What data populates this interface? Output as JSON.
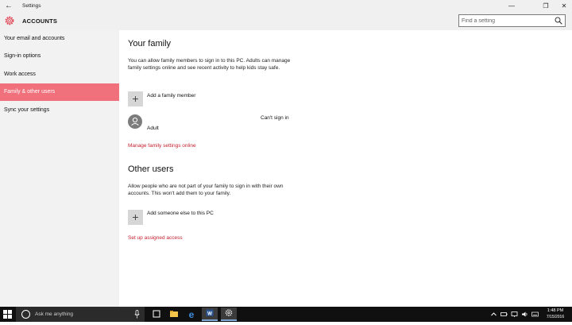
{
  "window": {
    "title": "Settings"
  },
  "header": {
    "section": "ACCOUNTS",
    "search_placeholder": "Find a setting"
  },
  "sidebar": {
    "items": [
      {
        "label": "Your email and accounts"
      },
      {
        "label": "Sign-in options"
      },
      {
        "label": "Work access"
      },
      {
        "label": "Family & other users",
        "active": true
      },
      {
        "label": "Sync your settings"
      }
    ]
  },
  "family": {
    "heading": "Your family",
    "description": "You can allow family members to sign in to this PC. Adults can manage family settings online and see recent activity to help kids stay safe.",
    "add_member": "Add a family member",
    "member_role": "Adult",
    "member_status": "Can't sign in",
    "manage_link": "Manage family settings online"
  },
  "other_users": {
    "heading": "Other users",
    "description": "Allow people who are not part of your family to sign in with their own accounts. This won't add them to your family.",
    "add_someone": "Add someone else to this PC",
    "assigned_access_link": "Set up assigned access"
  },
  "taskbar": {
    "search_text": "Ask me anything",
    "time": "1:48 PM",
    "date": "7/15/2016",
    "apps": [
      "task-view",
      "file-explorer",
      "edge",
      "word",
      "settings"
    ]
  },
  "colors": {
    "accent": "#f0707c",
    "link": "#c41e2e",
    "taskbar": "#101010"
  }
}
